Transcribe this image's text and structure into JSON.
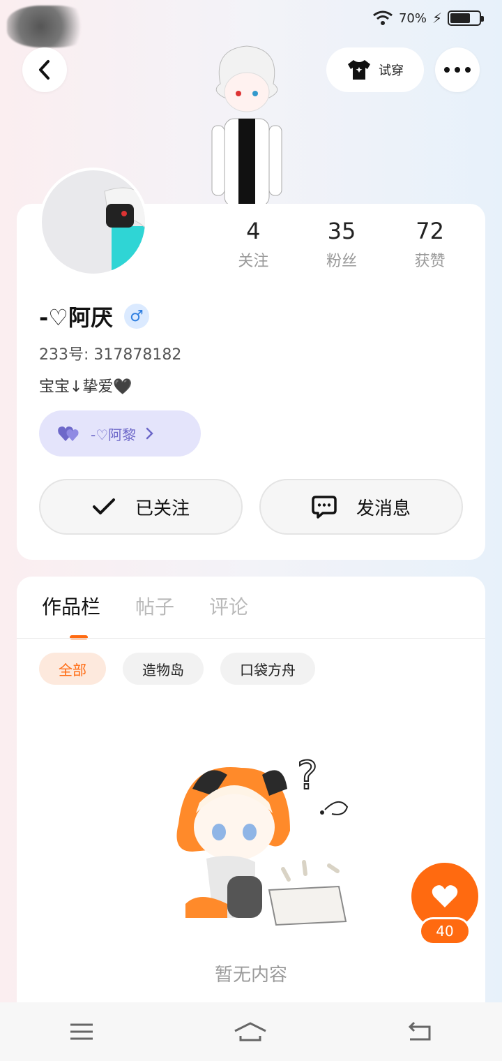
{
  "status_bar": {
    "battery_percent": "70%",
    "battery_level": 0.7
  },
  "header": {
    "try_on_label": "试穿"
  },
  "profile": {
    "stats": [
      {
        "value": "4",
        "label": "关注"
      },
      {
        "value": "35",
        "label": "粉丝"
      },
      {
        "value": "72",
        "label": "获赞"
      }
    ],
    "name": "-♡阿厌",
    "gender_symbol": "♂",
    "uid": "233号: 317878182",
    "bio": "宝宝↓挚爱🖤",
    "cp_name": "-♡阿黎"
  },
  "actions": {
    "follow_label": "已关注",
    "message_label": "发消息"
  },
  "tabs": [
    "作品栏",
    "帖子",
    "评论"
  ],
  "chips": [
    "全部",
    "造物岛",
    "口袋方舟"
  ],
  "empty": {
    "text": "暂无内容"
  },
  "fab": {
    "count": "40"
  },
  "colors": {
    "accent": "#ff6a10",
    "cp_bg": "#e4e4fb",
    "gender": "#2f7fe0"
  }
}
